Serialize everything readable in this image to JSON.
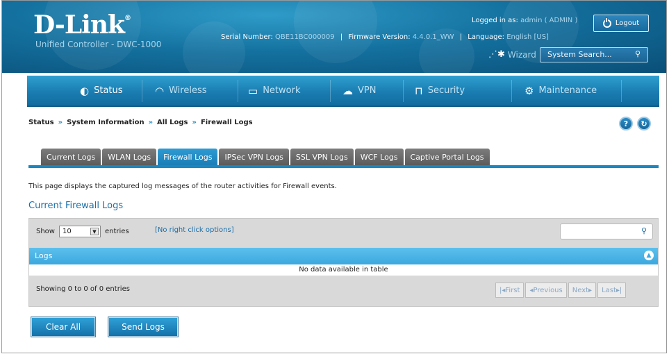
{
  "brand": {
    "logo_text": "D-Link",
    "registered": "®",
    "subtitle": "Unified Controller - DWC-1000"
  },
  "session": {
    "serial_label": "Serial Number:",
    "serial_value": "QBE11BC000009",
    "firmware_label": "Firmware Version:",
    "firmware_value": "4.4.0.1_WW",
    "language_label": "Language:",
    "language_value": "English [US]",
    "logged_label": "Logged in as:",
    "logged_value": "admin ( ADMIN )",
    "logout_label": "Logout",
    "wizard_label": "Wizard",
    "search_placeholder": "System Search..."
  },
  "nav": [
    {
      "label": "Status",
      "icon": "dashboard-icon",
      "active": true
    },
    {
      "label": "Wireless",
      "icon": "wifi-icon"
    },
    {
      "label": "Network",
      "icon": "monitor-icon"
    },
    {
      "label": "VPN",
      "icon": "cloud-lock-icon"
    },
    {
      "label": "Security",
      "icon": "lock-icon"
    },
    {
      "label": "Maintenance",
      "icon": "gears-icon"
    }
  ],
  "breadcrumb": [
    "Status",
    "System Information",
    "All Logs",
    "Firewall Logs"
  ],
  "breadcrumb_sep": "»",
  "tabs": [
    "Current Logs",
    "WLAN Logs",
    "Firewall Logs",
    "IPSec VPN Logs",
    "SSL VPN Logs",
    "WCF Logs",
    "Captive Portal Logs"
  ],
  "active_tab": "Firewall Logs",
  "description": "This page displays the captured log messages of the router activities for Firewall events.",
  "section_title": "Current Firewall Logs",
  "table": {
    "show_label": "Show",
    "show_value": "10",
    "entries_label": "entries",
    "no_right_click": "[No right click options]",
    "column": "Logs",
    "empty_text": "No data available in table",
    "info": "Showing 0 to 0 of 0 entries",
    "pager": {
      "first": "First",
      "previous": "Previous",
      "next": "Next",
      "last": "Last"
    }
  },
  "actions": {
    "clear_all": "Clear All",
    "send_logs": "Send Logs"
  }
}
